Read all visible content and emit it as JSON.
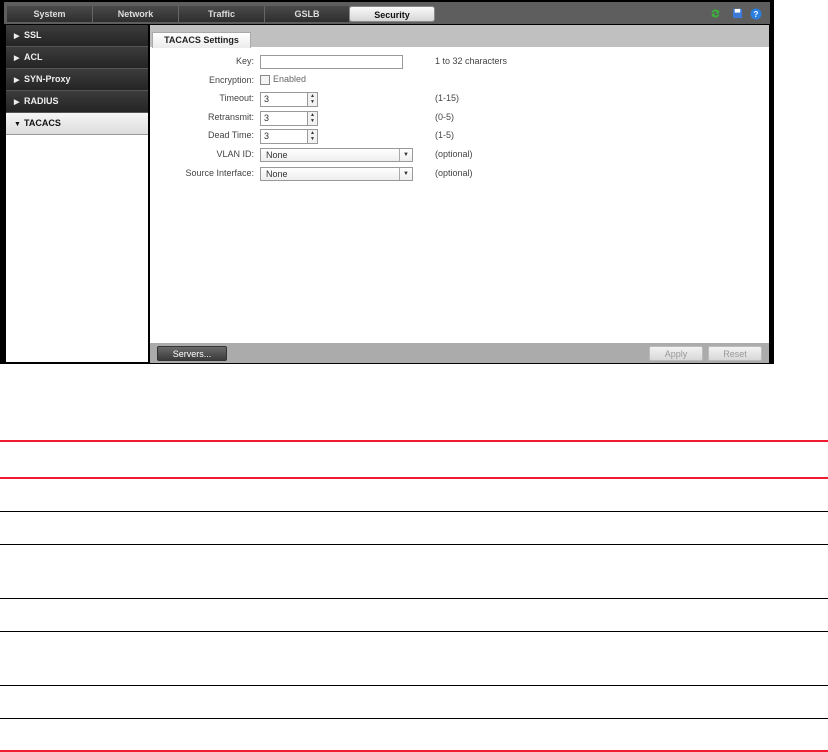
{
  "topnav": {
    "tabs": [
      "System",
      "Network",
      "Traffic",
      "GSLB",
      "Security"
    ],
    "active": "Security",
    "icons": [
      "refresh-icon",
      "save-icon",
      "help-icon"
    ],
    "colors": {
      "refresh": "#3bb33b",
      "save": "#3d7bd6",
      "help": "#2a7fe0"
    }
  },
  "sidebar": {
    "items": [
      {
        "label": "SSL",
        "arrow": "▶"
      },
      {
        "label": "ACL",
        "arrow": "▶"
      },
      {
        "label": "SYN-Proxy",
        "arrow": "▶"
      },
      {
        "label": "RADIUS",
        "arrow": "▶"
      },
      {
        "label": "TACACS",
        "arrow": "▼"
      }
    ]
  },
  "content": {
    "tab": "TACACS Settings",
    "key": {
      "label": "Key:",
      "value": "",
      "hint": "1 to 32 characters"
    },
    "encryption": {
      "label": "Encryption:",
      "checkbox_label": "Enabled",
      "checked": false
    },
    "timeout": {
      "label": "Timeout:",
      "value": "3",
      "hint": "(1-15)"
    },
    "retransmit": {
      "label": "Retransmit:",
      "value": "3",
      "hint": "(0-5)"
    },
    "dead_time": {
      "label": "Dead Time:",
      "value": "3",
      "hint": "(1-5)"
    },
    "vlan": {
      "label": "VLAN ID:",
      "value": "None",
      "hint": "(optional)"
    },
    "source_interface": {
      "label": "Source Interface:",
      "value": "None",
      "hint": "(optional)"
    }
  },
  "footer": {
    "servers": "Servers...",
    "apply": "Apply",
    "reset": "Reset"
  }
}
